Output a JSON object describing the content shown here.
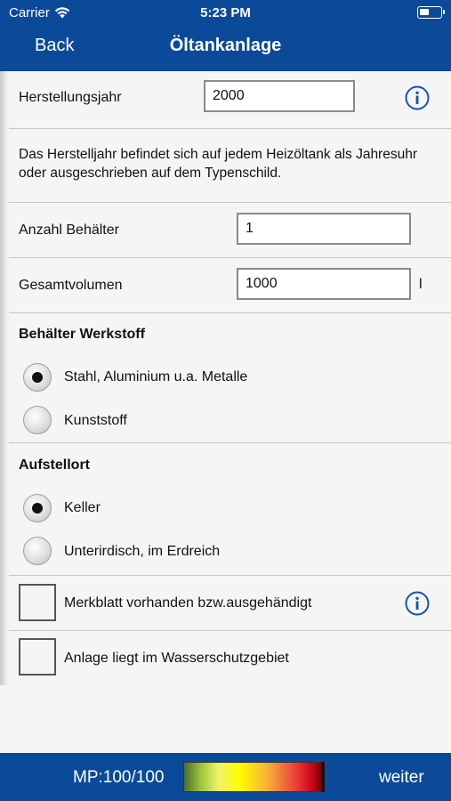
{
  "status_bar": {
    "carrier": "Carrier",
    "time": "5:23 PM"
  },
  "nav": {
    "back_label": "Back",
    "title": "Öltankanlage"
  },
  "form": {
    "herstellungsjahr": {
      "label": "Herstellungsjahr",
      "value": "2000"
    },
    "description": "Das Herstelljahr befindet sich auf jedem Heizöltank als Jahresuhr oder ausgeschrieben auf dem Typenschild.",
    "anzahl_behaelter": {
      "label": "Anzahl Behälter",
      "value": "1"
    },
    "gesamtvolumen": {
      "label": "Gesamtvolumen",
      "value": "1000",
      "unit": "l"
    },
    "werkstoff": {
      "heading": "Behälter Werkstoff",
      "options": [
        {
          "label": "Stahl, Aluminium u.a. Metalle",
          "selected": true
        },
        {
          "label": "Kunststoff",
          "selected": false
        }
      ]
    },
    "aufstellort": {
      "heading": "Aufstellort",
      "options": [
        {
          "label": "Keller",
          "selected": true
        },
        {
          "label": "Unterirdisch, im Erdreich",
          "selected": false
        }
      ]
    },
    "checkboxes": [
      {
        "label": "Merkblatt vorhanden bzw.ausgehändigt",
        "checked": false
      },
      {
        "label": "Anlage liegt im Wasserschutzgebiet",
        "checked": false
      }
    ]
  },
  "footer": {
    "mp_label": "MP:100/100",
    "progress": 1.0,
    "next_label": "weiter"
  },
  "colors": {
    "brand_blue": "#0b4a99",
    "info_blue": "#1a52a8"
  },
  "icons": {
    "info": "info-circle-icon",
    "wifi": "wifi-icon",
    "battery": "battery-icon"
  }
}
